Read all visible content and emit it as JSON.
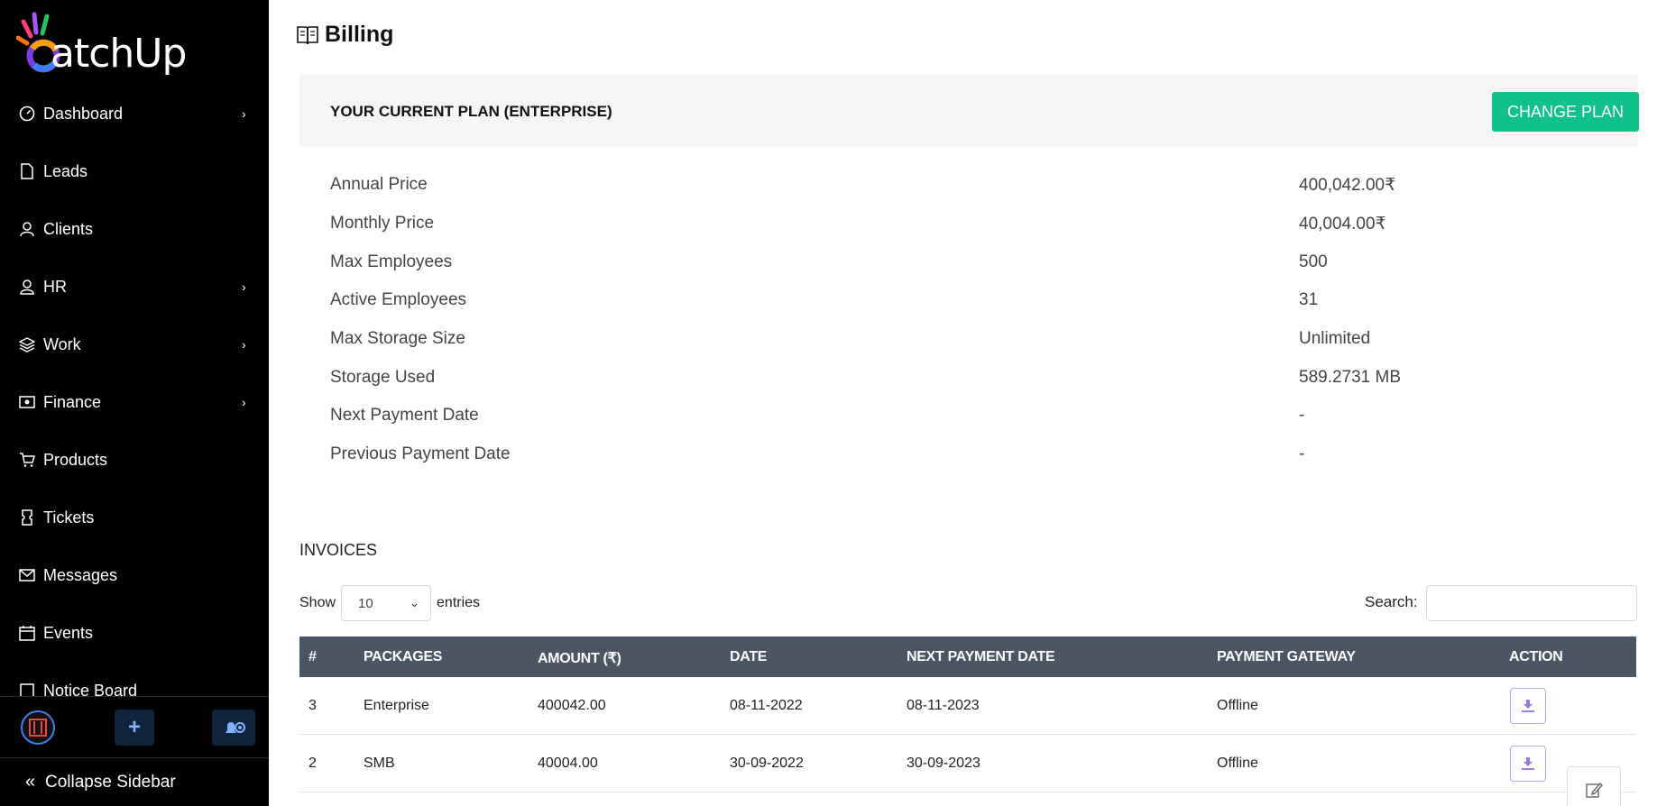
{
  "app": {
    "name": "atchUp"
  },
  "sidebar": {
    "items": [
      {
        "label": "Dashboard",
        "icon": "dashboard-gauge-icon",
        "has_submenu": true
      },
      {
        "label": "Leads",
        "icon": "file-icon",
        "has_submenu": false
      },
      {
        "label": "Clients",
        "icon": "user-tie-icon",
        "has_submenu": false
      },
      {
        "label": "HR",
        "icon": "user-icon",
        "has_submenu": true
      },
      {
        "label": "Work",
        "icon": "layers-icon",
        "has_submenu": true
      },
      {
        "label": "Finance",
        "icon": "cash-icon",
        "has_submenu": true
      },
      {
        "label": "Products",
        "icon": "cart-icon",
        "has_submenu": false
      },
      {
        "label": "Tickets",
        "icon": "ticket-icon",
        "has_submenu": false
      },
      {
        "label": "Messages",
        "icon": "envelope-icon",
        "has_submenu": false
      },
      {
        "label": "Events",
        "icon": "calendar-icon",
        "has_submenu": false
      },
      {
        "label": "Notice Board",
        "icon": "clipboard-icon",
        "has_submenu": false
      }
    ],
    "collapse_label": "Collapse Sidebar"
  },
  "page": {
    "title": "Billing"
  },
  "plan": {
    "title": "YOUR CURRENT PLAN (ENTERPRISE)",
    "change_button": "CHANGE PLAN",
    "details": [
      {
        "label": "Annual Price",
        "value": "400,042.00₹"
      },
      {
        "label": "Monthly Price",
        "value": "40,004.00₹"
      },
      {
        "label": "Max Employees",
        "value": "500"
      },
      {
        "label": "Active Employees",
        "value": "31"
      },
      {
        "label": "Max Storage Size",
        "value": "Unlimited"
      },
      {
        "label": "Storage Used",
        "value": "589.2731 MB"
      },
      {
        "label": "Next Payment Date",
        "value": "-"
      },
      {
        "label": "Previous Payment Date",
        "value": "-"
      }
    ]
  },
  "invoices": {
    "heading": "INVOICES",
    "show_label": "Show",
    "entries_value": "10",
    "entries_label": "entries",
    "search_label": "Search:",
    "search_value": "",
    "columns": [
      "#",
      "PACKAGES",
      "AMOUNT (₹)",
      "DATE",
      "NEXT PAYMENT DATE",
      "PAYMENT GATEWAY",
      "ACTION"
    ],
    "rows": [
      {
        "id": "3",
        "package": "Enterprise",
        "amount": "400042.00",
        "date": "08-11-2022",
        "next_payment": "08-11-2023",
        "gateway": "Offline"
      },
      {
        "id": "2",
        "package": "SMB",
        "amount": "40004.00",
        "date": "30-09-2022",
        "next_payment": "30-09-2023",
        "gateway": "Offline"
      }
    ]
  },
  "colors": {
    "sidebar_bg": "#000000",
    "accent_green": "#10c28a",
    "table_header_bg": "#4b5563",
    "download_icon": "#9b7be0"
  }
}
